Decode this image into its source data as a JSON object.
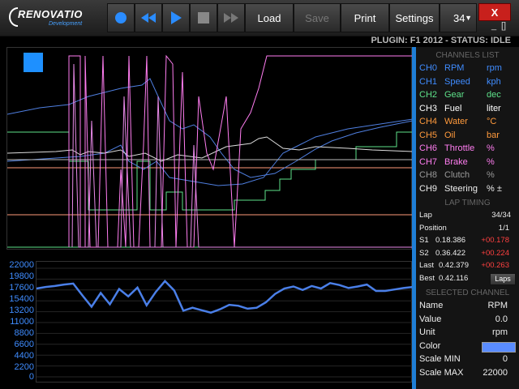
{
  "toolbar": {
    "logo_text": "RENOVATIO",
    "logo_sub": "Development",
    "load": "Load",
    "save": "Save",
    "print": "Print",
    "settings": "Settings",
    "session": "34",
    "close": "X",
    "restore": "[]"
  },
  "status_line": "PLUGIN: F1 2012 - STATUS: IDLE",
  "channels": {
    "title": "CHANNELS LIST",
    "items": [
      {
        "id": "CH0",
        "name": "RPM",
        "unit": "rpm",
        "color": "#3f8cff"
      },
      {
        "id": "CH1",
        "name": "Speed",
        "unit": "kph",
        "color": "#3f8cff"
      },
      {
        "id": "CH2",
        "name": "Gear",
        "unit": "dec",
        "color": "#5ee28a"
      },
      {
        "id": "CH3",
        "name": "Fuel",
        "unit": "liter",
        "color": "#ffffff"
      },
      {
        "id": "CH4",
        "name": "Water",
        "unit": "°C",
        "color": "#ff9a3c"
      },
      {
        "id": "CH5",
        "name": "Oil",
        "unit": "bar",
        "color": "#ff9a3c"
      },
      {
        "id": "CH6",
        "name": "Throttle",
        "unit": "%",
        "color": "#ff7df0"
      },
      {
        "id": "CH7",
        "name": "Brake",
        "unit": "%",
        "color": "#ff7df0"
      },
      {
        "id": "CH8",
        "name": "Clutch",
        "unit": "%",
        "color": "#999999"
      },
      {
        "id": "CH9",
        "name": "Steering",
        "unit": "% ±",
        "color": "#eeeeee"
      }
    ]
  },
  "lap_timing": {
    "title": "LAP TIMING",
    "lap_label": "Lap",
    "lap_value": "34/34",
    "position_label": "Position",
    "position_value": "1/1",
    "s1_label": "S1",
    "s1_time": "0.18.386",
    "s1_delta": "+00.178",
    "s2_label": "S2",
    "s2_time": "0.36.422",
    "s2_delta": "+00.224",
    "last_label": "Last",
    "last_time": "0.42.379",
    "last_delta": "+00.263",
    "best_label": "Best",
    "best_time": "0.42.116",
    "laps_button": "Laps",
    "delta_color": "#ff4040"
  },
  "selected_channel": {
    "title": "SELECTED CHANNEL",
    "name_label": "Name",
    "name_value": "RPM",
    "value_label": "Value",
    "value_value": "0.0",
    "unit_label": "Unit",
    "unit_value": "rpm",
    "color_label": "Color",
    "color_value": "#5a8cff",
    "min_label": "Scale MIN",
    "min_value": "0",
    "max_label": "Scale MAX",
    "max_value": "22000"
  },
  "rpm_axis": [
    "22000",
    "19800",
    "17600",
    "15400",
    "13200",
    "11000",
    "8800",
    "6600",
    "4400",
    "2200",
    "0"
  ],
  "chart_data": {
    "type": "line",
    "series": [
      {
        "name": "RPM",
        "values": [
          17900,
          18200,
          18400,
          18700,
          18900,
          16500,
          14200,
          17000,
          14700,
          17800,
          16300,
          18100,
          14500,
          17200,
          19400,
          17500,
          13400,
          14000,
          13500,
          13000,
          13700,
          14600,
          14400,
          13800,
          14000,
          15100,
          16800,
          17900,
          18300,
          17600,
          18400,
          17900,
          19000,
          18600,
          18000,
          18300,
          18700,
          17400,
          17400,
          17700,
          18000,
          18200
        ]
      }
    ],
    "ylim": [
      0,
      22000
    ]
  }
}
